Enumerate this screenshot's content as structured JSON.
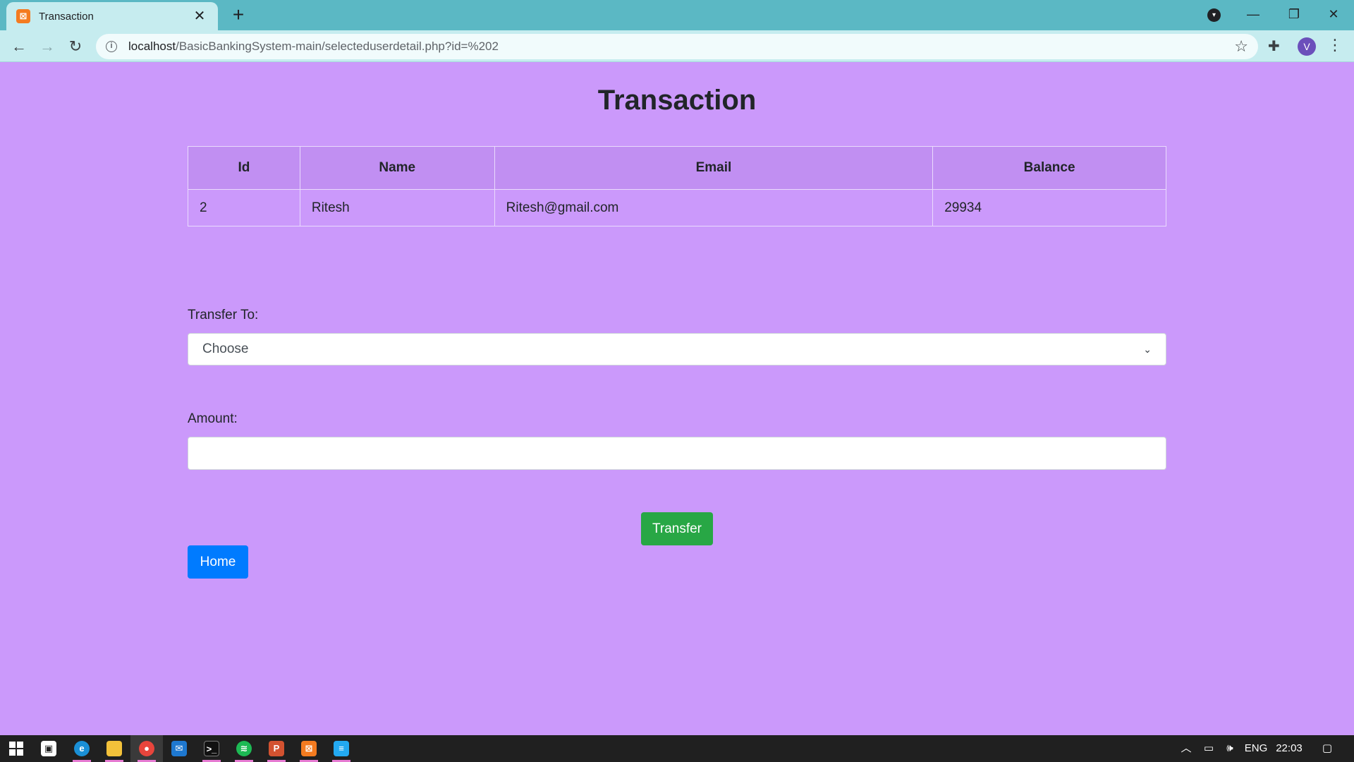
{
  "browser": {
    "tab_title": "Transaction",
    "tab_close": "✕",
    "new_tab": "+",
    "url_host": "localhost",
    "url_path": "/BasicBankingSystem-main/selecteduserdetail.php?id=%202",
    "profile_initial": "V",
    "window": {
      "minimize": "—",
      "restore": "❐",
      "close": "✕"
    }
  },
  "page": {
    "title": "Transaction",
    "table": {
      "headers": [
        "Id",
        "Name",
        "Email",
        "Balance"
      ],
      "row": [
        "2",
        "Ritesh",
        "Ritesh@gmail.com",
        "29934"
      ]
    },
    "transfer_label": "Transfer To:",
    "transfer_select_value": "Choose",
    "amount_label": "Amount:",
    "amount_value": "",
    "transfer_button": "Transfer",
    "home_button": "Home"
  },
  "taskbar": {
    "apps": [
      {
        "name": "start-icon"
      },
      {
        "name": "store-icon"
      },
      {
        "name": "edge-icon"
      },
      {
        "name": "file-explorer-icon"
      },
      {
        "name": "chrome-icon"
      },
      {
        "name": "mail-icon"
      },
      {
        "name": "terminal-icon"
      },
      {
        "name": "spotify-icon"
      },
      {
        "name": "powerpoint-icon"
      },
      {
        "name": "xampp-icon"
      },
      {
        "name": "vscode-icon"
      }
    ],
    "language": "ENG",
    "time": "22:03"
  },
  "colors": {
    "page_bg": "#cb99fb",
    "header_bg": "#c18ff2",
    "transfer_btn": "#28a745",
    "home_btn": "#007bff",
    "chrome_frame": "#5bb8c4"
  }
}
